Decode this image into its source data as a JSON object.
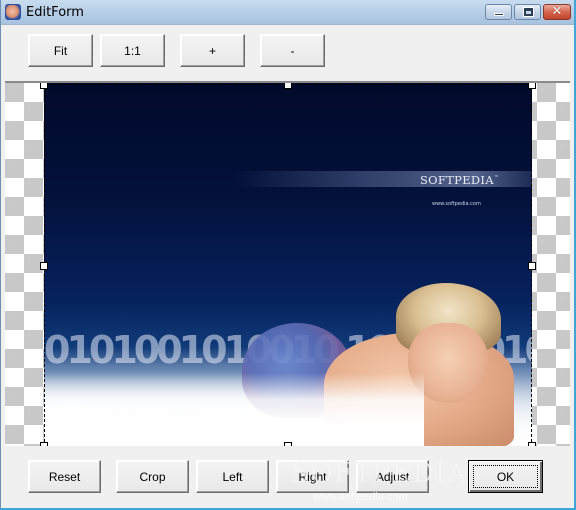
{
  "window": {
    "title": "EditForm",
    "controls": {
      "minimize_icon": "minimize-icon",
      "maximize_icon": "maximize-icon",
      "close_glyph": "✕"
    }
  },
  "toolbar": {
    "fit_label": "Fit",
    "actual_size_label": "1:1",
    "zoom_in_label": "+",
    "zoom_out_label": "-"
  },
  "image": {
    "brand_text": "SOFTPEDIA",
    "brand_tm": "™",
    "brand_url": "www.softpedia.com",
    "binary_text": "0101001010010 1001010100101",
    "selection": "dashed crop rectangle with 8 resize handles"
  },
  "actions": {
    "reset_label": "Reset",
    "crop_label": "Crop",
    "left_label": "Left",
    "right_label": "Right",
    "adjust_label": "Adjust",
    "ok_label": "OK"
  },
  "watermark": {
    "text": "SOFTPEDIA",
    "url": "www.softpedia.com"
  }
}
